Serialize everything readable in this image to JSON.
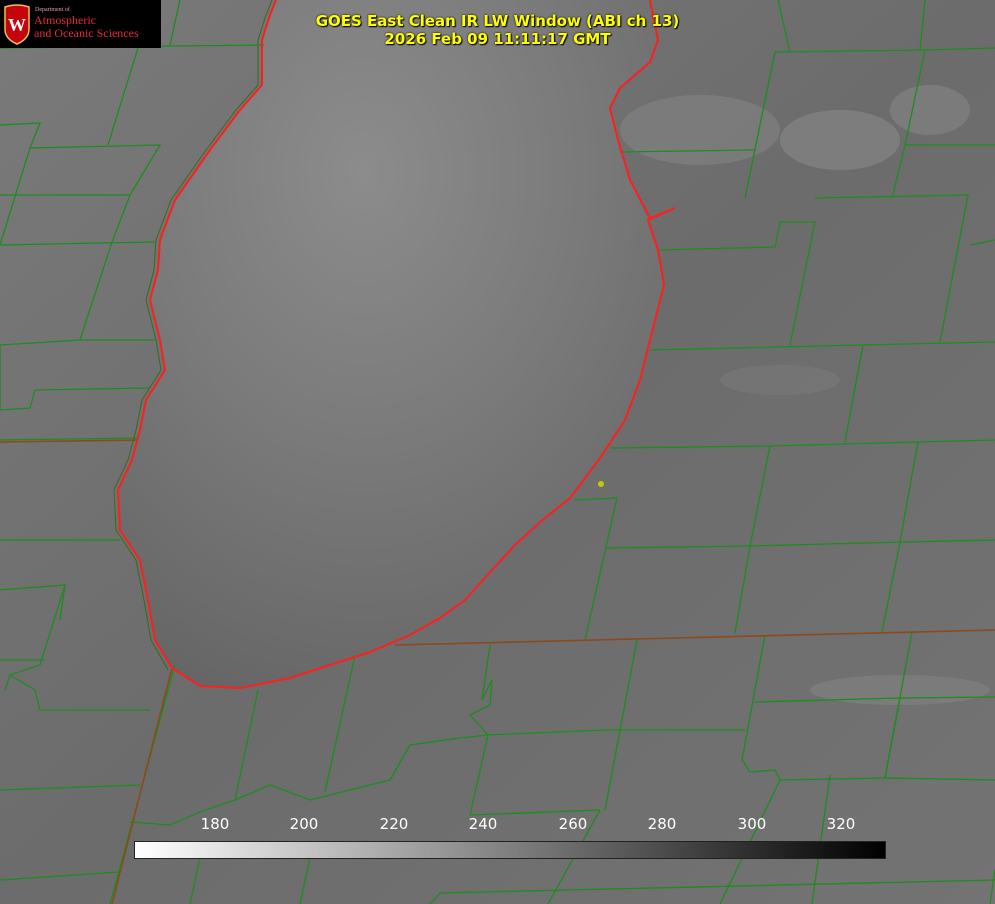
{
  "header": {
    "title_line1": "GOES East Clean IR LW Window (ABI ch 13)",
    "title_line2": "2026 Feb 09 11:11:17 GMT"
  },
  "logo": {
    "department": "Department of",
    "line1": "Atmospheric",
    "line2": "and Oceanic Sciences",
    "emblem_letter": "W",
    "emblem": "uw-crest"
  },
  "colorbar": {
    "ticks": [
      "180",
      "200",
      "220",
      "240",
      "260",
      "280",
      "300",
      "320"
    ],
    "gradient_from": "#ffffff",
    "gradient_to": "#000000"
  },
  "colors": {
    "title": "#ffff00",
    "boundary": "#1e8c1e",
    "coastline": "#ff1e1e",
    "marker": "#c8c800",
    "logo_text": "#e8283c"
  }
}
